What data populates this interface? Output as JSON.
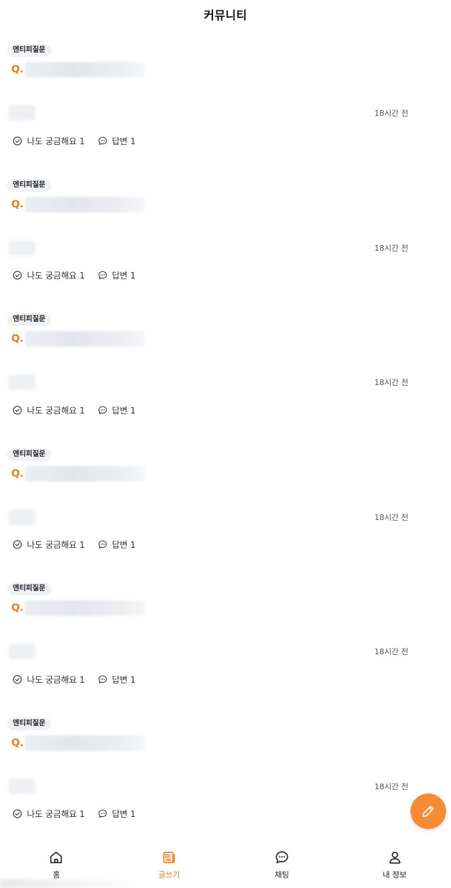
{
  "header": {
    "title": "커뮤니티"
  },
  "posts": [
    {
      "tag": "엔티피질문",
      "q_mark": "Q.",
      "time": "18시간 전",
      "curious_label": "나도 궁금해요 1",
      "answer_label": "답변 1"
    },
    {
      "tag": "엔티피질문",
      "q_mark": "Q.",
      "time": "18시간 전",
      "curious_label": "나도 궁금해요 1",
      "answer_label": "답변 1"
    },
    {
      "tag": "엔티피질문",
      "q_mark": "Q.",
      "time": "18시간 전",
      "curious_label": "나도 궁금해요 1",
      "answer_label": "답변 1"
    },
    {
      "tag": "엔티피질문",
      "q_mark": "Q.",
      "time": "18시간 전",
      "curious_label": "나도 궁금해요 1",
      "answer_label": "답변 1"
    },
    {
      "tag": "엔티피질문",
      "q_mark": "Q.",
      "time": "18시간 전",
      "curious_label": "나도 궁금해요 1",
      "answer_label": "답변 1"
    },
    {
      "tag": "엔티피질문",
      "q_mark": "Q.",
      "time": "18시간 전",
      "curious_label": "나도 궁금해요 1",
      "answer_label": "답변 1"
    }
  ],
  "fab": {
    "icon": "pencil-icon"
  },
  "tabs": [
    {
      "label": "홈",
      "icon": "home-icon",
      "active": false
    },
    {
      "label": "글쓰기",
      "icon": "write-icon",
      "active": true
    },
    {
      "label": "채팅",
      "icon": "chat-icon",
      "active": false
    },
    {
      "label": "내 정보",
      "icon": "user-icon",
      "active": false
    }
  ],
  "colors": {
    "accent": "#f07a1a",
    "fab": "#f68b35",
    "badge_bg": "#f0f1f4"
  }
}
